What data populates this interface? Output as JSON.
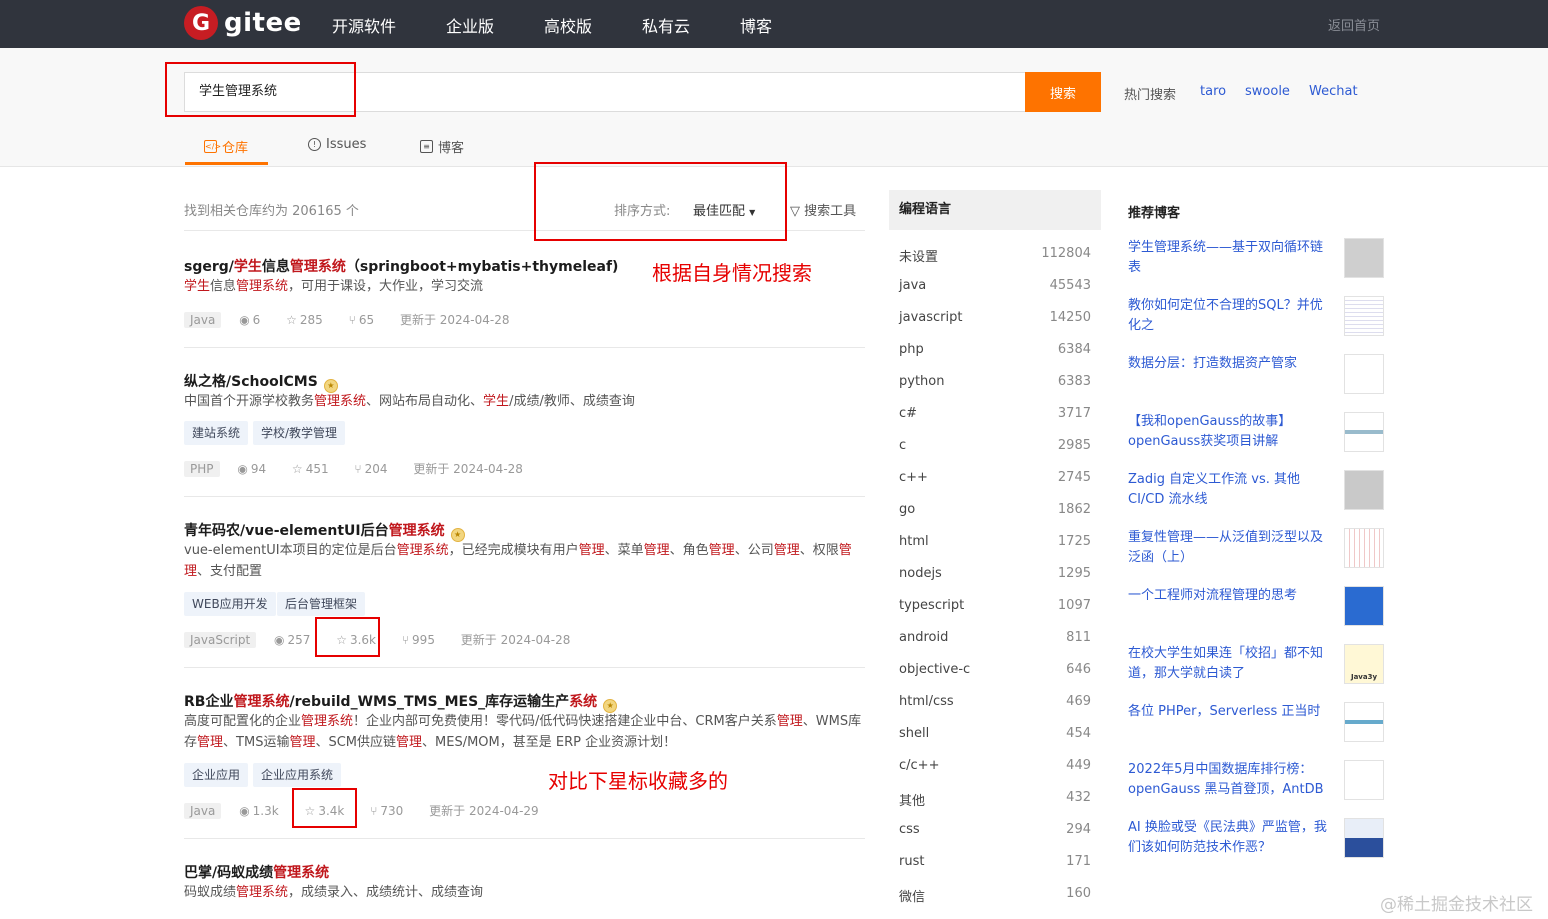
{
  "nav": {
    "logo_letter": "G",
    "logo_text": "gitee",
    "items": [
      "开源软件",
      "企业版",
      "高校版",
      "私有云",
      "博客"
    ],
    "back_home": "返回首页"
  },
  "search": {
    "query": "学生管理系统",
    "button": "搜索",
    "hot_label": "热门搜索",
    "hot_links": [
      "taro",
      "swoole",
      "Wechat"
    ]
  },
  "tabs": [
    "仓库",
    "Issues",
    "博客"
  ],
  "results": {
    "count_text": "找到相关仓库约为 206165 个",
    "sort_label": "排序方式:",
    "sort_value": "最佳匹配",
    "search_tools": "搜索工具"
  },
  "repos": [
    {
      "title_parts": [
        "sgerg/",
        "学生",
        "信息",
        "管理系统",
        "（springboot+mybatis+thymeleaf)"
      ],
      "desc_parts": [
        "学生",
        "信息",
        "管理系统",
        "，可用于课设，大作业，学习交流"
      ],
      "tags": [],
      "lang": "Java",
      "watch": "6",
      "stars": "285",
      "forks": "65",
      "updated": "更新于 2024-04-28"
    },
    {
      "title_parts": [
        "纵之格/SchoolCMS"
      ],
      "desc_parts": [
        "中国首个开源学校教务",
        "管理系统",
        "、网站布局自动化、",
        "学生",
        "/成绩/教师、成绩查询"
      ],
      "tags": [
        "建站系统",
        "学校/教学管理"
      ],
      "lang": "PHP",
      "watch": "94",
      "stars": "451",
      "forks": "204",
      "updated": "更新于 2024-04-28"
    },
    {
      "title_parts": [
        "青年码农/vue-elementUI后台",
        "管理系统"
      ],
      "desc_parts": [
        "vue-elementUI本项目的定位是后台",
        "管理系统",
        "，已经完成模块有用户",
        "管理",
        "、菜单",
        "管理",
        "、角色",
        "管理",
        "、公司",
        "管理",
        "、权限",
        "管理",
        "、支付配置"
      ],
      "tags": [
        "WEB应用开发",
        "后台管理框架"
      ],
      "lang": "JavaScript",
      "watch": "257",
      "stars": "3.6k",
      "forks": "995",
      "updated": "更新于 2024-04-28"
    },
    {
      "title_parts": [
        "RB企业",
        "管理系统",
        "/rebuild_WMS_TMS_MES_库存运输生产",
        "系统"
      ],
      "desc_parts": [
        "高度可配置化的企业",
        "管理系统",
        "！企业内部可免费使用！零代码/低代码快速搭建企业中台、CRM客户关系",
        "管理",
        "、WMS库存",
        "管理",
        "、TMS运输",
        "管理",
        "、SCM供应链",
        "管理",
        "、MES/MOM，甚至是 ERP 企业资源计划！"
      ],
      "tags": [
        "企业应用",
        "企业应用系统"
      ],
      "lang": "Java",
      "watch": "1.3k",
      "stars": "3.4k",
      "forks": "730",
      "updated": "更新于 2024-04-29"
    },
    {
      "title_parts": [
        "巴掌/码蚁成绩",
        "管理系统"
      ],
      "desc_parts": [
        "码蚁成绩",
        "管理系统",
        "，成绩录入、成绩统计、成绩查询"
      ],
      "tags": [],
      "lang": "",
      "watch": "",
      "stars": "",
      "forks": "",
      "updated": ""
    }
  ],
  "annotations": {
    "search_note": "根据自身情况搜索",
    "star_note": "对比下星标收藏多的"
  },
  "languages": {
    "header": "编程语言",
    "rows": [
      {
        "name": "未设置",
        "count": "112804"
      },
      {
        "name": "java",
        "count": "45543"
      },
      {
        "name": "javascript",
        "count": "14250"
      },
      {
        "name": "php",
        "count": "6384"
      },
      {
        "name": "python",
        "count": "6383"
      },
      {
        "name": "c#",
        "count": "3717"
      },
      {
        "name": "c",
        "count": "2985"
      },
      {
        "name": "c++",
        "count": "2745"
      },
      {
        "name": "go",
        "count": "1862"
      },
      {
        "name": "html",
        "count": "1725"
      },
      {
        "name": "nodejs",
        "count": "1295"
      },
      {
        "name": "typescript",
        "count": "1097"
      },
      {
        "name": "android",
        "count": "811"
      },
      {
        "name": "objective-c",
        "count": "646"
      },
      {
        "name": "html/css",
        "count": "469"
      },
      {
        "name": "shell",
        "count": "454"
      },
      {
        "name": "c/c++",
        "count": "449"
      },
      {
        "name": "其他",
        "count": "432"
      },
      {
        "name": "css",
        "count": "294"
      },
      {
        "name": "rust",
        "count": "171"
      },
      {
        "name": "微信",
        "count": "160"
      }
    ]
  },
  "recommend": {
    "header": "推荐博客",
    "items": [
      "学生管理系统——基于双向循环链表",
      "教你如何定位不合理的SQL？并优化之",
      "数据分层：打造数据资产管家",
      "【我和openGauss的故事】openGauss获奖项目讲解",
      "Zadig 自定义工作流 vs. 其他 CI/CD 流水线",
      "重复性管理——从泛值到泛型以及泛函（上）",
      "一个工程师对流程管理的思考",
      "在校大学生如果连「校招」都不知道，那大学就白读了",
      "各位 PHPer，Serverless 正当时",
      "2022年5月中国数据库排行榜：openGauss 黑马首登顶，AntDB",
      "AI 换脸或受《民法典》严监管，我们该如何防范技术作恶？"
    ],
    "thumb_text_java3y": "Java3y"
  },
  "watermark": "@稀土掘金技术社区",
  "colors": {
    "nav_bg": "#30343d",
    "accent": "#fe7300",
    "highlight": "#c0171c",
    "link": "#2d5ad3",
    "annotation": "#e60000"
  }
}
